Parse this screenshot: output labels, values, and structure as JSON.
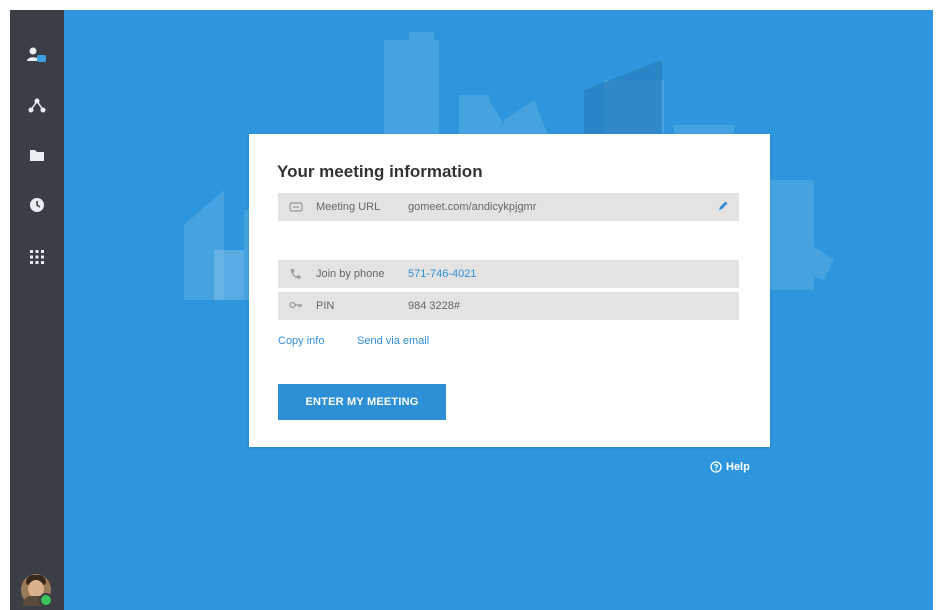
{
  "colors": {
    "sidebar": "#3b3e44",
    "background": "#2d96dc",
    "accent": "#2d8fd6",
    "link": "#2f8ed6",
    "row": "#e3e3e3"
  },
  "sidebar": {
    "items": [
      {
        "name": "contacts",
        "icon": "person-badge-icon"
      },
      {
        "name": "share",
        "icon": "network-icon"
      },
      {
        "name": "files",
        "icon": "folder-icon"
      },
      {
        "name": "history",
        "icon": "clock-icon"
      },
      {
        "name": "apps",
        "icon": "grid-icon"
      }
    ],
    "avatar": {
      "status": "online"
    }
  },
  "meeting": {
    "title": "Your meeting information",
    "url_label": "Meeting URL",
    "url_value": "gomeet.com/andicykpjgmr",
    "phone_label": "Join by phone",
    "phone_value": "571-746-4021",
    "pin_label": "PIN",
    "pin_value": "984 3228#",
    "copy_info": "Copy info",
    "send_email": "Send via email",
    "enter_button": "ENTER MY MEETING"
  },
  "help": {
    "label": "Help"
  }
}
